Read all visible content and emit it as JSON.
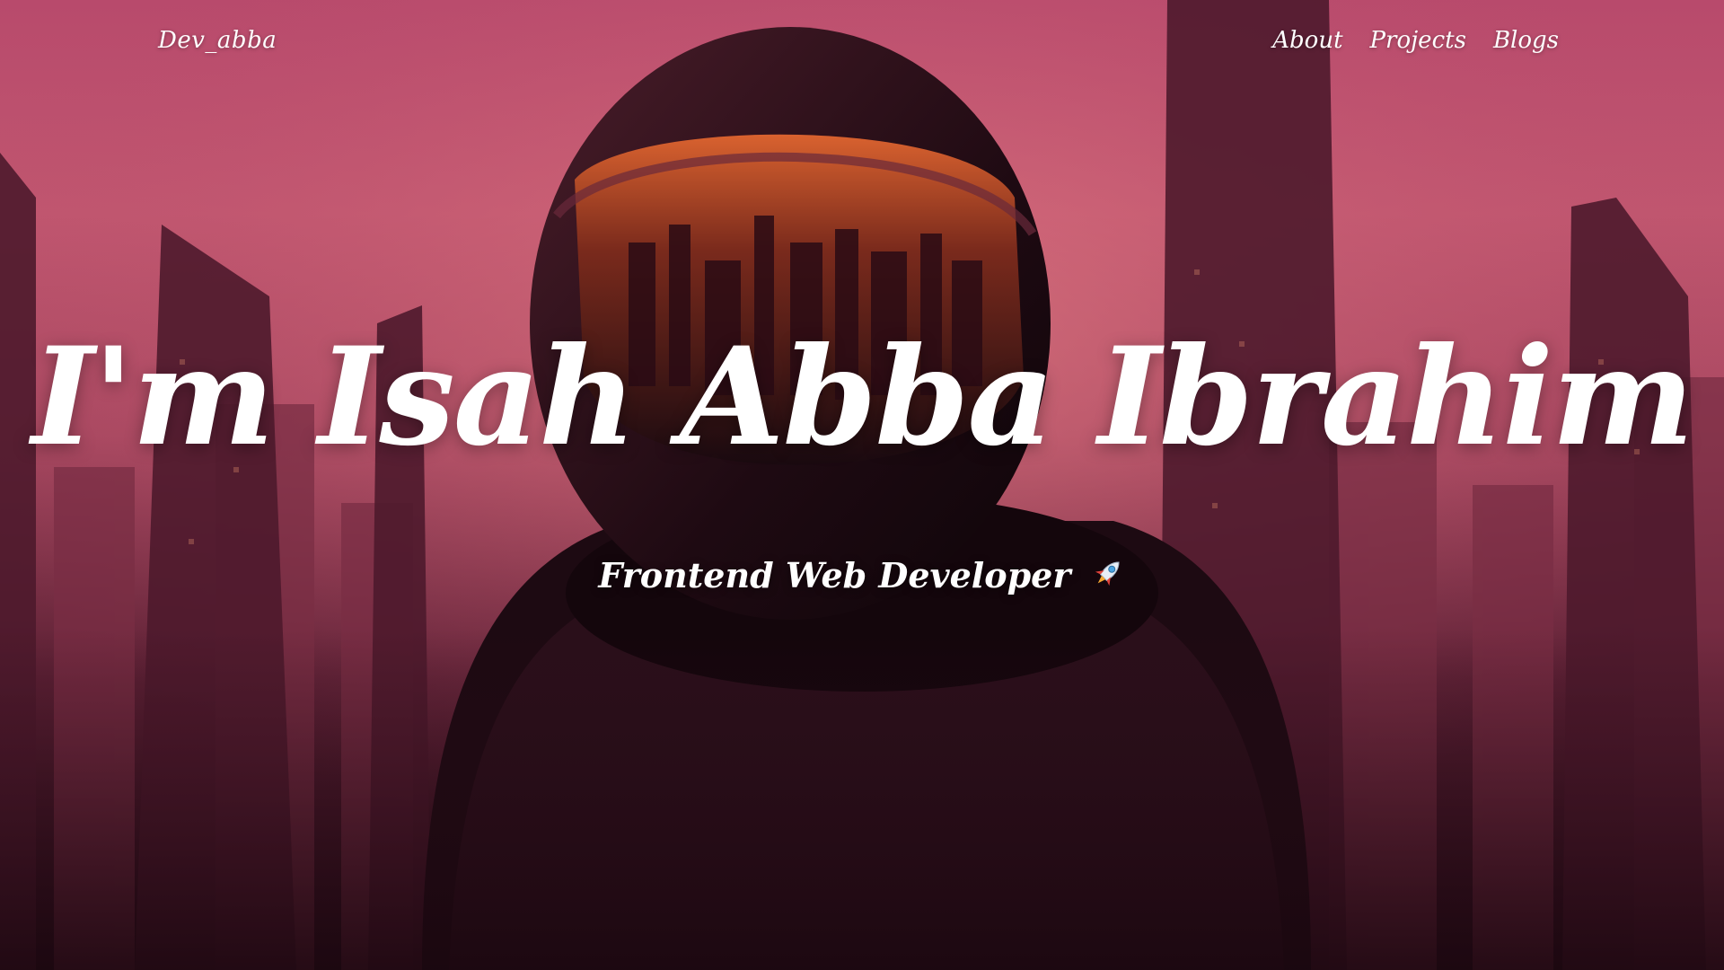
{
  "nav": {
    "brand": "Dev_abba",
    "links": [
      "About",
      "Projects",
      "Blogs"
    ]
  },
  "hero": {
    "title": "I'm Isah Abba Ibrahim",
    "subtitle": "Frontend Web Developer",
    "subtitle_icon": "rocket-icon"
  },
  "colors": {
    "sky_top": "#b84a6c",
    "sky_mid": "#c0566f",
    "ground": "#2a0c18",
    "text": "#ffffff"
  }
}
